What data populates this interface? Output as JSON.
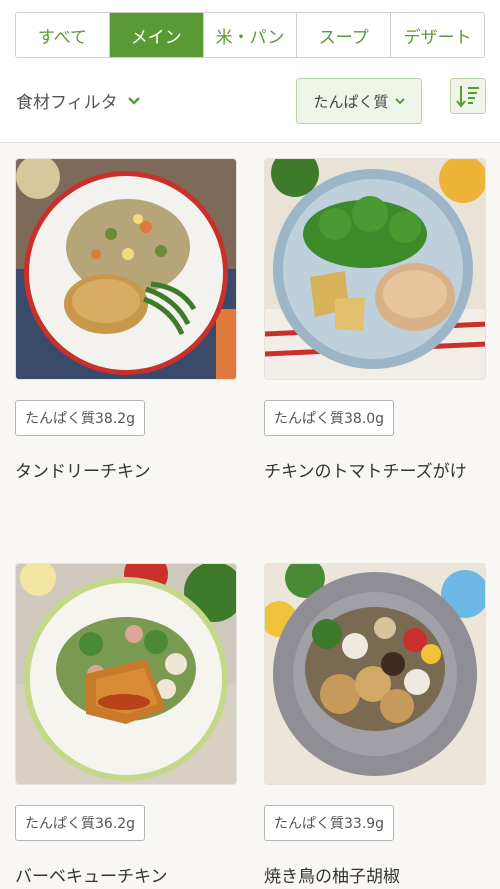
{
  "tabs": [
    {
      "label": "すべて",
      "active": false
    },
    {
      "label": "メイン",
      "active": true
    },
    {
      "label": "米・パン",
      "active": false
    },
    {
      "label": "スープ",
      "active": false
    },
    {
      "label": "デザート",
      "active": false
    }
  ],
  "filter": {
    "label": "食材フィルタ",
    "icon": "chevron-down-icon"
  },
  "sort": {
    "selected": "たんぱく質",
    "icon": "sort-descending-icon"
  },
  "products": [
    {
      "badge": "たんぱく質38.2g",
      "name": "タンドリーチキン"
    },
    {
      "badge": "たんぱく質38.0g",
      "name": "チキンのトマトチーズがけ"
    },
    {
      "badge": "たんぱく質36.2g",
      "name": "バーベキューチキン"
    },
    {
      "badge": "たんぱく質33.9g",
      "name": "焼き鳥の柚子胡椒"
    }
  ],
  "colors": {
    "accent": "#5a9a35",
    "accent_light": "#eef5e8",
    "background": "#f8f7f4"
  }
}
